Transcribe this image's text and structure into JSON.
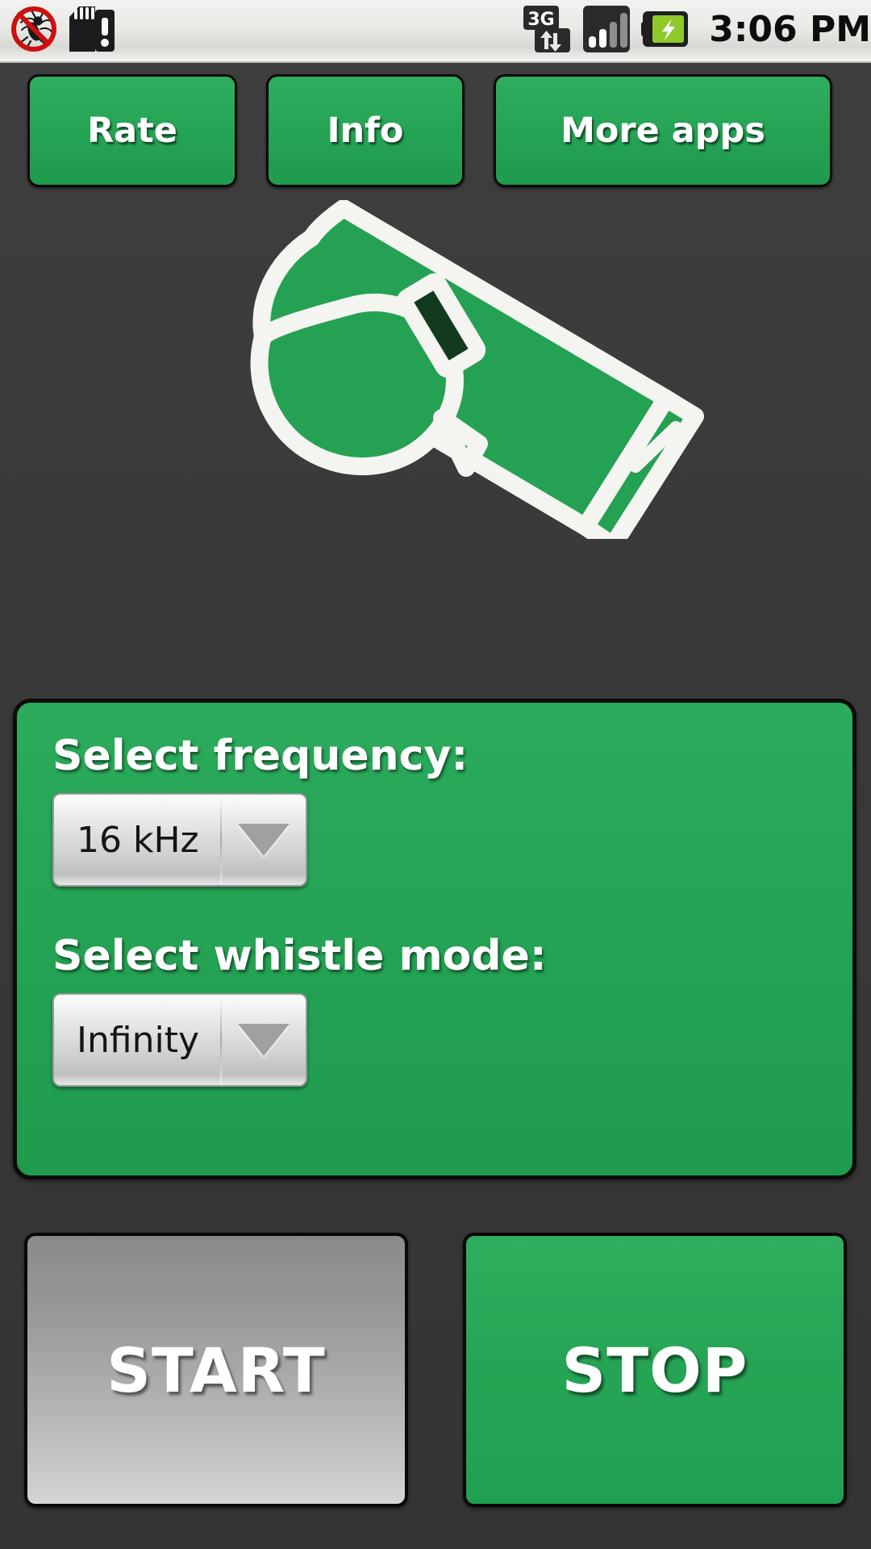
{
  "status_bar": {
    "time": "3:06 PM",
    "left_icons": [
      {
        "name": "mosquito-blocked-icon",
        "label": "Anti-mosquito active"
      },
      {
        "name": "sd-card-warning-icon",
        "label": "SD card warning"
      }
    ],
    "right_icons": [
      {
        "name": "network-3g-icon",
        "label": "3G",
        "network_type": "3G"
      },
      {
        "name": "signal-bars-icon",
        "label": "Signal strength",
        "bars_total": 4,
        "bars_active": 2
      },
      {
        "name": "battery-charging-icon",
        "label": "Battery charging"
      }
    ]
  },
  "top_bar": {
    "rate_label": "Rate",
    "info_label": "Info",
    "more_apps_label": "More apps"
  },
  "illustration": {
    "name": "whistle-illustration",
    "alt": "Green sports whistle"
  },
  "settings": {
    "frequency_label": "Select frequency:",
    "frequency_value": "16 kHz",
    "mode_label": "Select whistle mode:",
    "mode_value": "Infinity"
  },
  "actions": {
    "start_label": "START",
    "stop_label": "STOP"
  },
  "colors": {
    "brand_green": "#25a355",
    "panel_green": "#24a354",
    "background_dark": "#3a3a3a",
    "button_border": "#0a0a0a",
    "start_gray": "#b3b2b0",
    "text_white": "#ffffff",
    "whistle_outline": "#f4f4f0",
    "whistle_fill": "#25a153",
    "whistle_hole": "#123a1f",
    "status_bar_bg": "#e9e9e6"
  }
}
